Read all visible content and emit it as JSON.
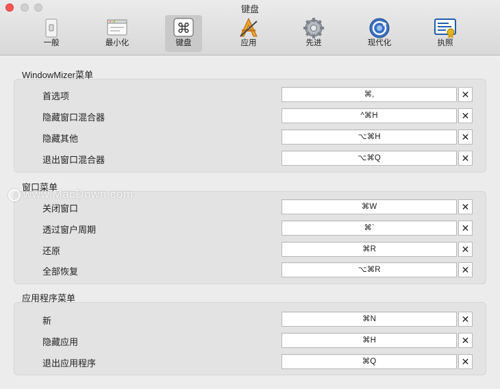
{
  "window": {
    "title": "键盘"
  },
  "toolbar": {
    "items": [
      {
        "label": "一般",
        "icon": "switch-icon"
      },
      {
        "label": "最小化",
        "icon": "window-icon"
      },
      {
        "label": "键盘",
        "icon": "command-key-icon",
        "selected": true
      },
      {
        "label": "应用",
        "icon": "app-store-icon"
      },
      {
        "label": "先进",
        "icon": "gear-icon"
      },
      {
        "label": "现代化",
        "icon": "refresh-icon"
      },
      {
        "label": "执照",
        "icon": "certificate-icon"
      }
    ]
  },
  "sections": [
    {
      "title": "WindowMizer菜单",
      "rows": [
        {
          "name": "首选项",
          "shortcut": "⌘,"
        },
        {
          "name": "隐藏窗口混合器",
          "shortcut": "^⌘H"
        },
        {
          "name": "隐藏其他",
          "shortcut": "⌥⌘H"
        },
        {
          "name": "退出窗口混合器",
          "shortcut": "⌥⌘Q"
        }
      ]
    },
    {
      "title": "窗口菜单",
      "rows": [
        {
          "name": "关闭窗口",
          "shortcut": "⌘W"
        },
        {
          "name": "透过窗户周期",
          "shortcut": "⌘`"
        },
        {
          "name": "还原",
          "shortcut": "⌘R"
        },
        {
          "name": "全部恢复",
          "shortcut": "⌥⌘R"
        }
      ]
    },
    {
      "title": "应用程序菜单",
      "rows": [
        {
          "name": "新",
          "shortcut": "⌘N"
        },
        {
          "name": "隐藏应用",
          "shortcut": "⌘H"
        },
        {
          "name": "退出应用程序",
          "shortcut": "⌘Q"
        }
      ]
    }
  ],
  "clear_glyph": "✕",
  "watermark": "www.MacDown.com",
  "colors": {
    "close": "#fc5753",
    "selected_tab": "#c9c9c9",
    "panel": "#e3e3e3"
  }
}
